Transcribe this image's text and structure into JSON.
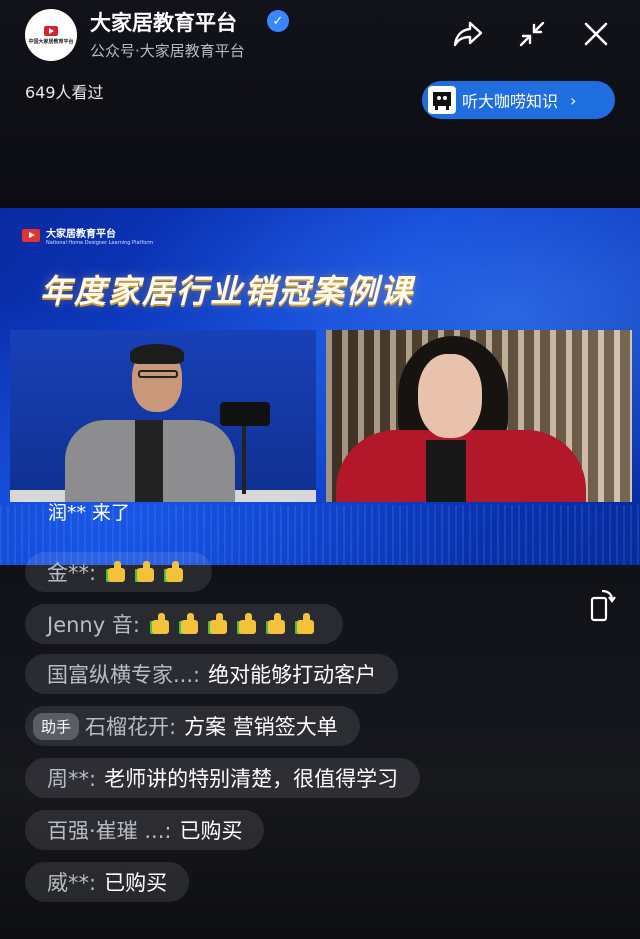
{
  "header": {
    "avatar_label": "中国大家居教育平台",
    "account_name": "大家居教育平台",
    "account_subtitle": "公众号·大家居教育平台",
    "viewers": "649人看过",
    "listen_pill_label": "听大咖唠知识",
    "listen_pill_chevron": "›",
    "verified_mark": "✓",
    "icons": [
      "share-icon",
      "collapse-icon",
      "close-icon"
    ]
  },
  "video": {
    "brand_cn": "大家居教育平台",
    "brand_en": "National Home Designer Learning Platform",
    "title": "年度家居行业销冠案例课",
    "overlay_comment": "润** 来了"
  },
  "comments": [
    {
      "badge": "",
      "user": "金**:",
      "msg": "",
      "thumbs": 3
    },
    {
      "badge": "",
      "user": "Jenny 音:",
      "msg": "",
      "thumbs": 6
    },
    {
      "badge": "",
      "user": "国富纵横专家...:",
      "msg": "绝对能够打动客户",
      "thumbs": 0
    },
    {
      "badge": "助手",
      "user": "石榴花开:",
      "msg": "方案 营销签大单",
      "thumbs": 0
    },
    {
      "badge": "",
      "user": "周**:",
      "msg": "老师讲的特别清楚，很值得学习",
      "thumbs": 0
    },
    {
      "badge": "",
      "user": "百强·崔璀 ...:",
      "msg": "已购买",
      "thumbs": 0
    },
    {
      "badge": "",
      "user": "威**:",
      "msg": "已购买",
      "thumbs": 0
    }
  ],
  "colors": {
    "accent": "#1f6ee0",
    "background": "#0e0f13",
    "title_gold": "#c99a2c"
  }
}
